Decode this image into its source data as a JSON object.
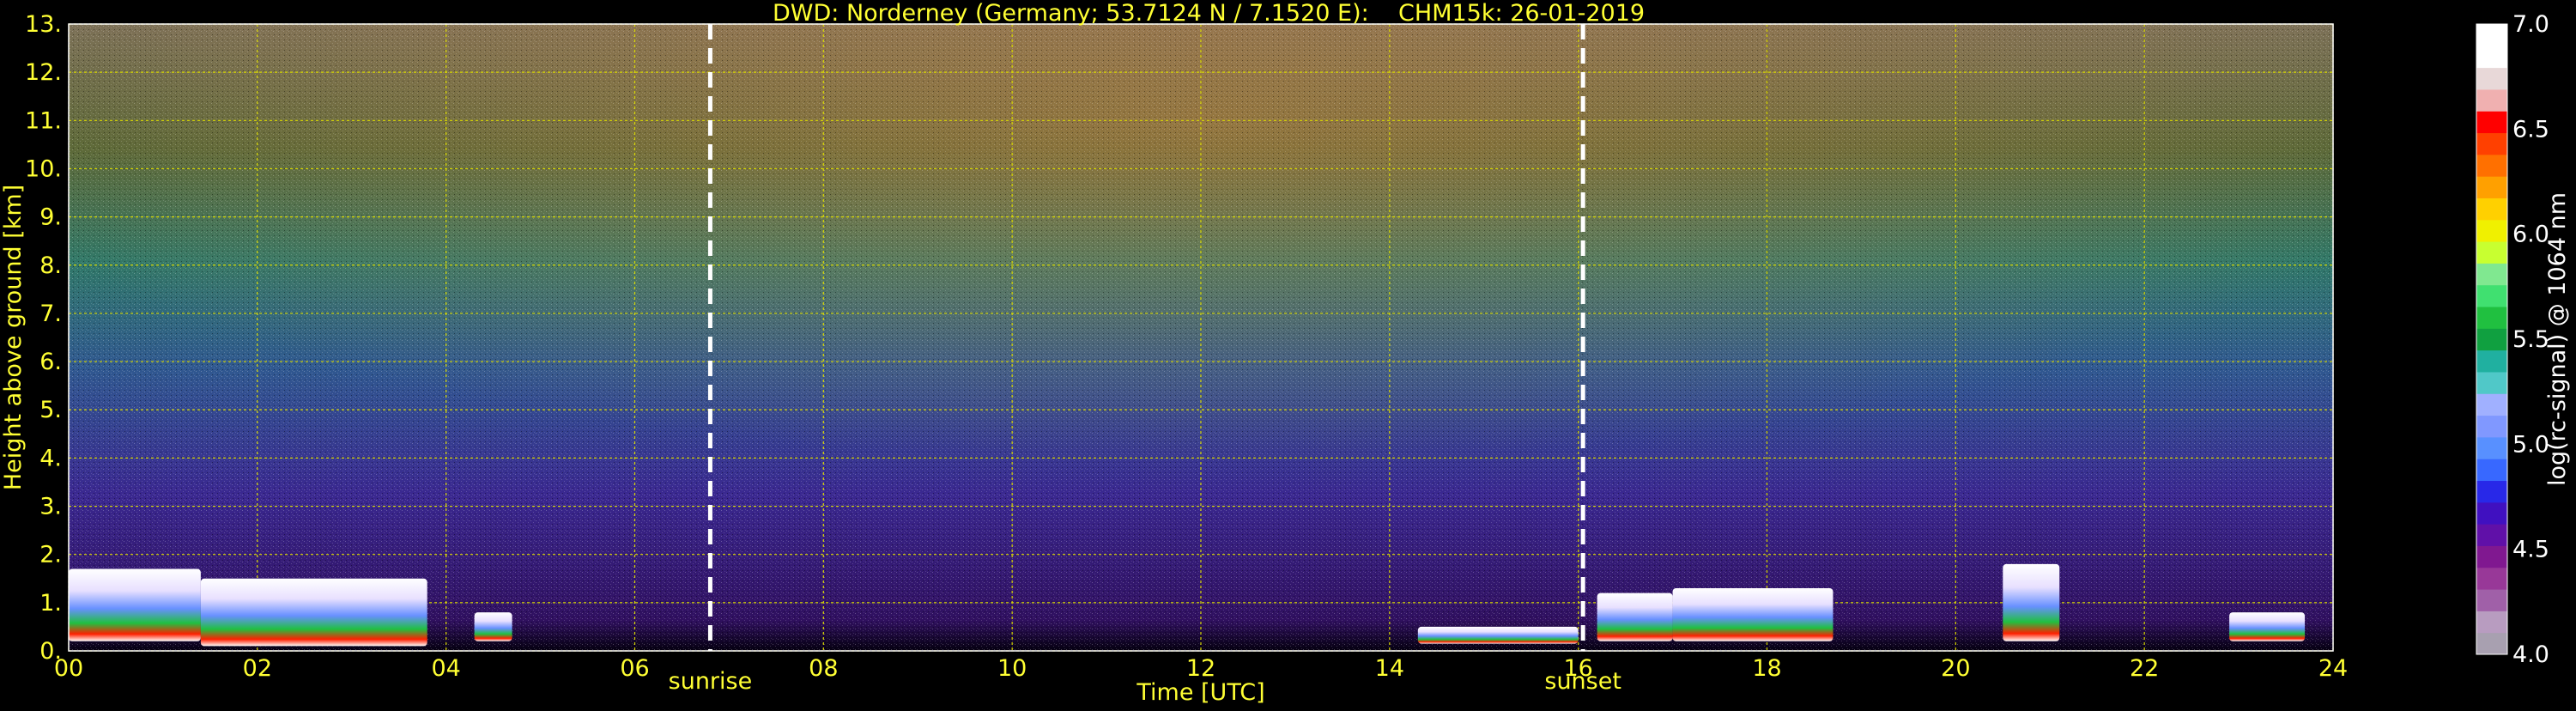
{
  "chart_data": {
    "type": "heatmap",
    "title": "DWD: Norderney (Germany; 53.7124 N / 7.1520 E):    CHM15k: 26-01-2019",
    "xlabel": "Time [UTC]",
    "ylabel": "Height above ground [km]",
    "xlim": [
      0,
      24
    ],
    "ylim": [
      0,
      13
    ],
    "xticks": [
      "00",
      "02",
      "04",
      "06",
      "08",
      "10",
      "12",
      "14",
      "16",
      "18",
      "20",
      "22",
      "24"
    ],
    "yticks": [
      "0.",
      "1.",
      "2.",
      "3.",
      "4.",
      "5.",
      "6.",
      "7.",
      "8.",
      "9.",
      "10.",
      "11.",
      "12.",
      "13."
    ],
    "grid": true,
    "annotations": [
      {
        "text": "sunrise",
        "x": 6.8
      },
      {
        "text": "sunset",
        "x": 16.05
      }
    ],
    "colorbar": {
      "label": "log(rc-signal) @ 1064 nm",
      "range": [
        4.0,
        7.0
      ],
      "ticks": [
        "4.0",
        "4.5",
        "5.0",
        "5.5",
        "6.0",
        "6.5",
        "7.0"
      ],
      "colors": [
        "#a8a0b0",
        "#b89cc0",
        "#a060a8",
        "#983898",
        "#801890",
        "#6010a8",
        "#4010c0",
        "#2828e8",
        "#3868ff",
        "#5890ff",
        "#8098ff",
        "#a0b0ff",
        "#50c8c8",
        "#20b0a0",
        "#10a040",
        "#20c040",
        "#40e070",
        "#80e890",
        "#c8ff30",
        "#f0f000",
        "#ffd000",
        "#ffa000",
        "#ff7000",
        "#ff4000",
        "#ff0000",
        "#f0b0b0",
        "#e8d8d8",
        "#ffffff",
        "#ffffff"
      ]
    },
    "cloud_layers": [
      {
        "x0": 0.0,
        "x1": 1.4,
        "base": 0.2,
        "top": 1.7
      },
      {
        "x0": 1.4,
        "x1": 3.8,
        "base": 0.1,
        "top": 1.5
      },
      {
        "x0": 4.3,
        "x1": 4.7,
        "base": 0.2,
        "top": 0.8
      },
      {
        "x0": 14.3,
        "x1": 16.0,
        "base": 0.15,
        "top": 0.5
      },
      {
        "x0": 16.2,
        "x1": 17.0,
        "base": 0.2,
        "top": 1.2
      },
      {
        "x0": 17.0,
        "x1": 18.7,
        "base": 0.2,
        "top": 1.3
      },
      {
        "x0": 20.5,
        "x1": 21.1,
        "base": 0.2,
        "top": 1.8
      },
      {
        "x0": 22.9,
        "x1": 23.7,
        "base": 0.2,
        "top": 0.8
      }
    ]
  }
}
